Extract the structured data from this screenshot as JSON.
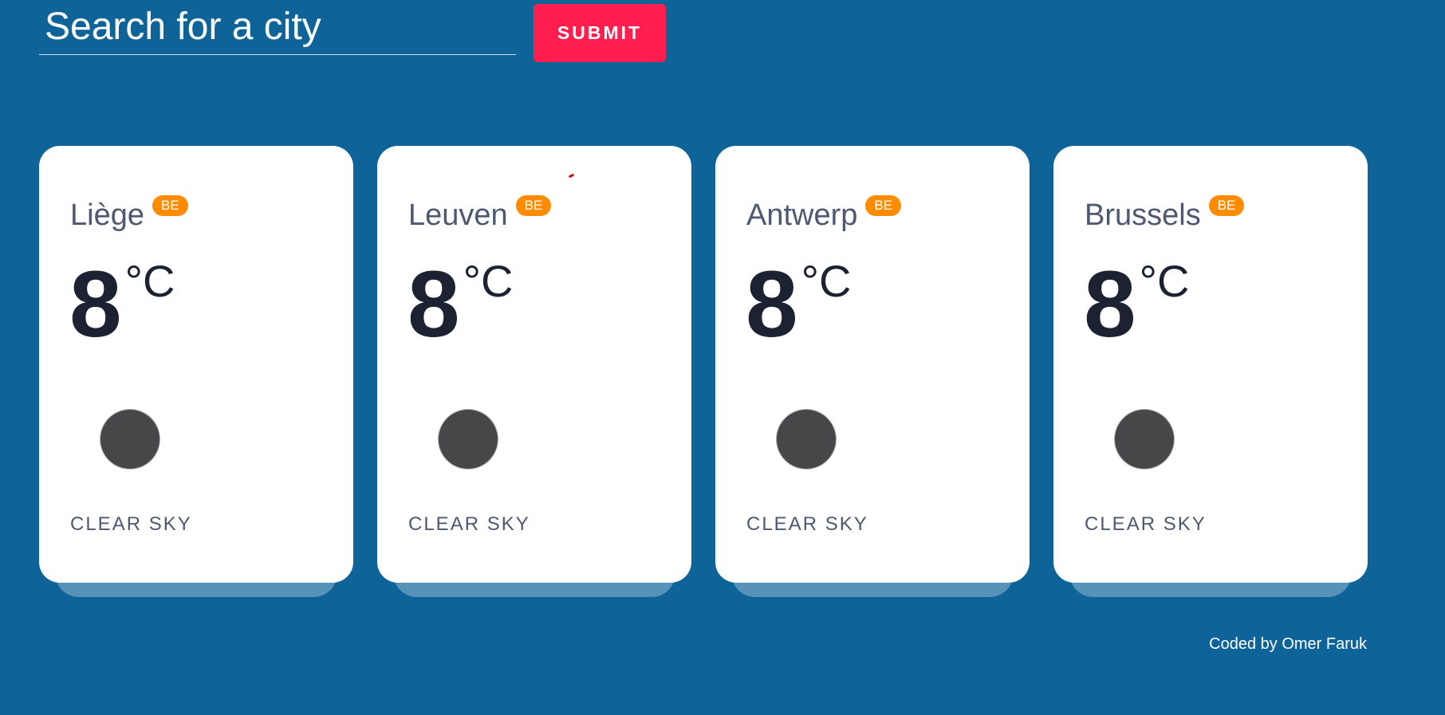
{
  "search": {
    "placeholder": "Search for a city",
    "submit_label": "SUBMIT"
  },
  "cities": [
    {
      "name": "Liège",
      "country": "BE",
      "temperature": "8",
      "unit": "°C",
      "icon": "clear-sky-icon",
      "description": "CLEAR SKY"
    },
    {
      "name": "Leuven",
      "country": "BE",
      "temperature": "8",
      "unit": "°C",
      "icon": "clear-sky-icon",
      "description": "CLEAR SKY"
    },
    {
      "name": "Antwerp",
      "country": "BE",
      "temperature": "8",
      "unit": "°C",
      "icon": "clear-sky-icon",
      "description": "CLEAR SKY"
    },
    {
      "name": "Brussels",
      "country": "BE",
      "temperature": "8",
      "unit": "°C",
      "icon": "clear-sky-icon",
      "description": "CLEAR SKY"
    }
  ],
  "footer": {
    "credit": "Coded by Omer Faruk"
  },
  "colors": {
    "background": "#0e6499",
    "submit": "#ff1e4d",
    "badge": "#ff8c00"
  }
}
